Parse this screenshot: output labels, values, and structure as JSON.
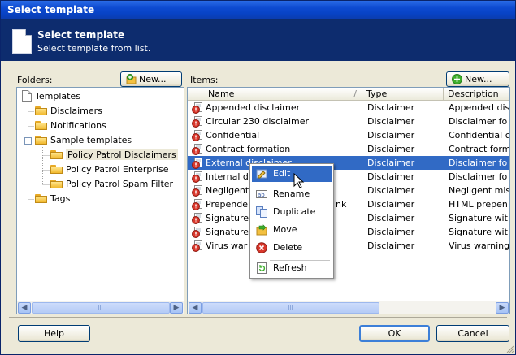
{
  "window": {
    "title": "Select template"
  },
  "banner": {
    "title": "Select template",
    "subtitle": "Select template from list."
  },
  "folders": {
    "label": "Folders:",
    "new_label": "New...",
    "tree": [
      {
        "label": "Templates",
        "icon": "document-icon"
      },
      {
        "label": "Disclaimers",
        "icon": "folder-icon"
      },
      {
        "label": "Notifications",
        "icon": "folder-icon"
      },
      {
        "label": "Sample templates",
        "icon": "folder-icon",
        "expanded": true
      },
      {
        "label": "Policy Patrol Disclaimers",
        "icon": "folder-icon",
        "selected": true
      },
      {
        "label": "Policy Patrol Enterprise",
        "icon": "folder-icon"
      },
      {
        "label": "Policy Patrol Spam Filter",
        "icon": "folder-icon"
      },
      {
        "label": "Tags",
        "icon": "folder-icon"
      }
    ]
  },
  "items": {
    "label": "Items:",
    "new_label": "New...",
    "columns": [
      "Name",
      "Type",
      "Description"
    ],
    "rows": [
      {
        "name": "Appended disclaimer",
        "type": "Disclaimer",
        "description": "Appended dis"
      },
      {
        "name": "Circular 230 disclaimer",
        "type": "Disclaimer",
        "description": "Disclaimer fo"
      },
      {
        "name": "Confidential",
        "type": "Disclaimer",
        "description": "Confidential c"
      },
      {
        "name": "Contract formation",
        "type": "Disclaimer",
        "description": "Contract form"
      },
      {
        "name": "External disclaimer",
        "type": "Disclaimer",
        "description": "Disclaimer fo",
        "selected": true
      },
      {
        "name": "Internal d",
        "type": "Disclaimer",
        "description": "Disclaimer fo"
      },
      {
        "name": "Negligent",
        "type": "Disclaimer",
        "description": "Negligent mis"
      },
      {
        "name": "Prepende",
        "suffix": "nk",
        "type": "Disclaimer",
        "description": "HTML prepen"
      },
      {
        "name": "Signature",
        "type": "Disclaimer",
        "description": "Signature wit"
      },
      {
        "name": "Signature",
        "type": "Disclaimer",
        "description": "Signature wit"
      },
      {
        "name": "Virus war",
        "type": "Disclaimer",
        "description": "Virus warning"
      }
    ]
  },
  "context_menu": {
    "items": [
      {
        "label": "Edit",
        "icon": "edit-icon",
        "highlighted": true
      },
      {
        "label": "Rename",
        "icon": "rename-icon"
      },
      {
        "label": "Duplicate",
        "icon": "duplicate-icon"
      },
      {
        "label": "Move",
        "icon": "move-icon"
      },
      {
        "label": "Delete",
        "icon": "delete-icon"
      },
      {
        "label": "Refresh",
        "icon": "refresh-icon"
      }
    ]
  },
  "footer": {
    "help_label": "Help",
    "ok_label": "OK",
    "cancel_label": "Cancel"
  },
  "colors": {
    "title_bar": "#0843c6",
    "banner": "#0d2c6e",
    "selection": "#316ac5",
    "dialog_bg": "#ece9d8"
  }
}
